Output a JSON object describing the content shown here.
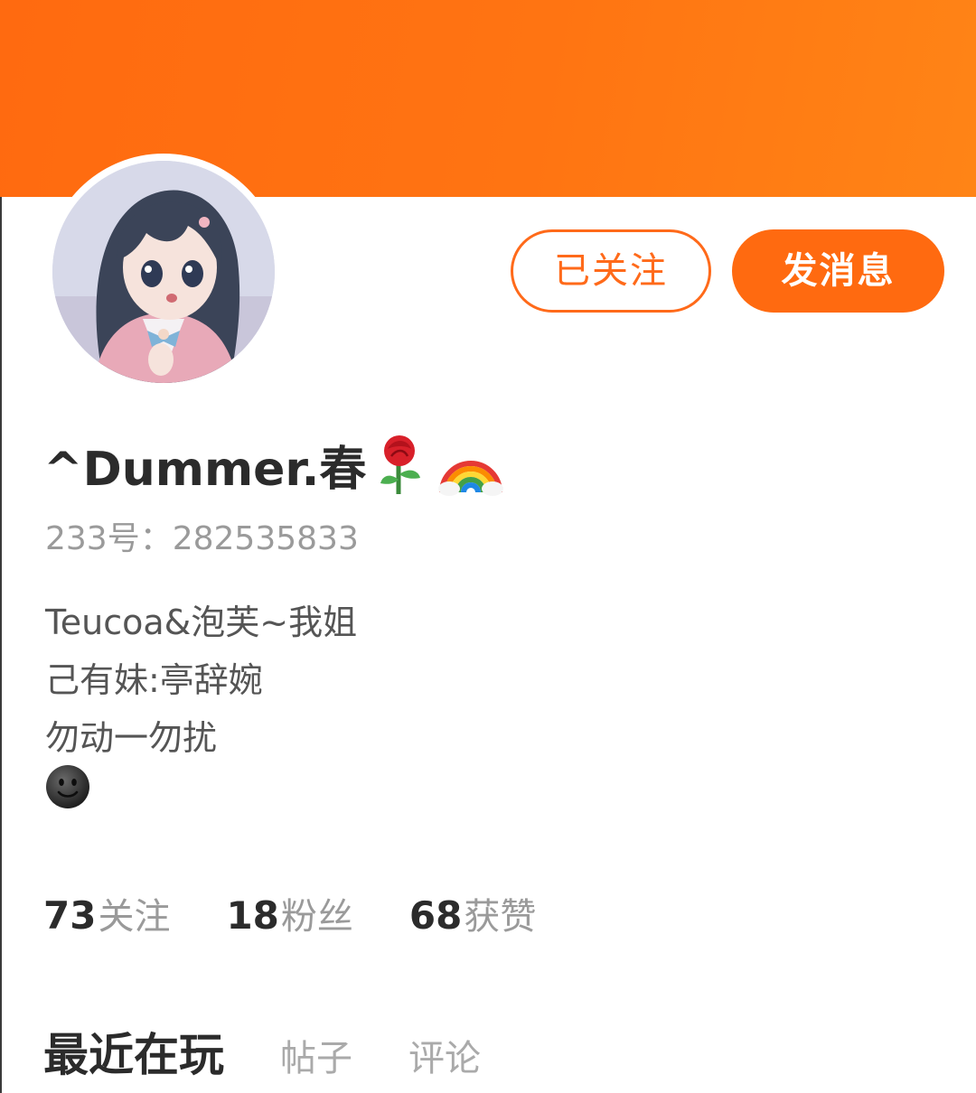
{
  "profile": {
    "username": "^Dummer.春",
    "name_emojis": [
      "rose-emoji",
      "rainbow-emoji"
    ],
    "uid_label": "233号：",
    "uid_value": "282535833",
    "bio_lines": [
      "Teucoa&泡芙~我姐",
      "己有妹:亭辞婉",
      "勿动一勿扰"
    ],
    "bio_emoji": "smiling-face-emoji"
  },
  "actions": {
    "follow_label": "已关注",
    "message_label": "发消息"
  },
  "stats": [
    {
      "value": "73",
      "label": "关注"
    },
    {
      "value": "18",
      "label": "粉丝"
    },
    {
      "value": "68",
      "label": "获赞"
    }
  ],
  "tabs": [
    {
      "label": "最近在玩",
      "active": true
    },
    {
      "label": "帖子",
      "active": false
    },
    {
      "label": "评论",
      "active": false
    }
  ],
  "colors": {
    "accent": "#ff6a10",
    "banner": "#ff7412",
    "text_dark": "#2b2b2b",
    "text_muted": "#9a9a9a"
  }
}
